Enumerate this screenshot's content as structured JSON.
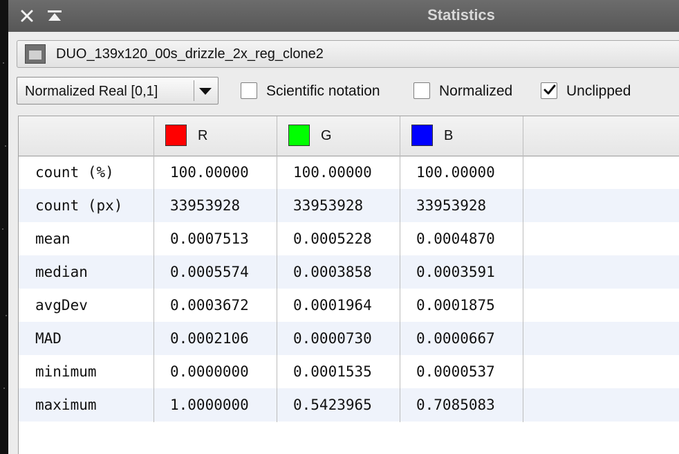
{
  "window": {
    "title": "Statistics"
  },
  "view": {
    "name": "DUO_139x120_00s_drizzle_2x_reg_clone2"
  },
  "controls": {
    "range_mode": "Normalized Real [0,1]",
    "scientific_notation": {
      "label": "Scientific notation",
      "checked": false
    },
    "normalized": {
      "label": "Normalized",
      "checked": false
    },
    "unclipped": {
      "label": "Unclipped",
      "checked": true
    }
  },
  "table": {
    "columns": [
      {
        "label": "R",
        "color": "#ff0000"
      },
      {
        "label": "G",
        "color": "#00ff00"
      },
      {
        "label": "B",
        "color": "#0000ff"
      }
    ],
    "rows": [
      {
        "label": "count (%)",
        "values": [
          "100.00000",
          "100.00000",
          "100.00000"
        ]
      },
      {
        "label": "count (px)",
        "values": [
          "33953928",
          "33953928",
          "33953928"
        ]
      },
      {
        "label": "mean",
        "values": [
          "0.0007513",
          "0.0005228",
          "0.0004870"
        ]
      },
      {
        "label": "median",
        "values": [
          "0.0005574",
          "0.0003858",
          "0.0003591"
        ]
      },
      {
        "label": "avgDev",
        "values": [
          "0.0003672",
          "0.0001964",
          "0.0001875"
        ]
      },
      {
        "label": "MAD",
        "values": [
          "0.0002106",
          "0.0000730",
          "0.0000667"
        ]
      },
      {
        "label": "minimum",
        "values": [
          "0.0000000",
          "0.0001535",
          "0.0000537"
        ]
      },
      {
        "label": "maximum",
        "values": [
          "1.0000000",
          "0.5423965",
          "0.7085083"
        ]
      }
    ]
  },
  "colors": {
    "titlebar": "#5f5f5f",
    "window_bg": "#ececec",
    "row_alt": "#eff3fb"
  }
}
